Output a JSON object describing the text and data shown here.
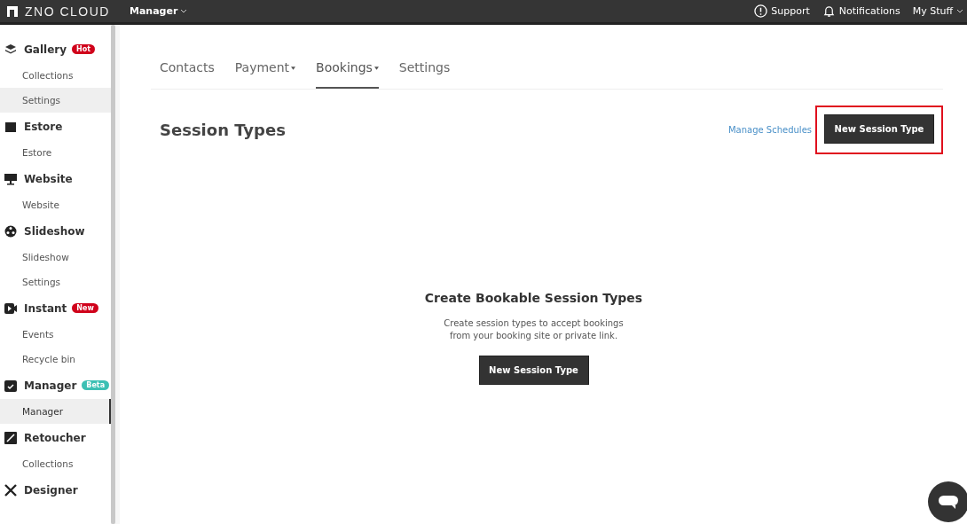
{
  "topbar": {
    "brand": "ZNO CLOUD",
    "menu": "Manager",
    "links": [
      {
        "kind": "support",
        "label": "Support"
      },
      {
        "kind": "bell",
        "label": "Notifications"
      },
      {
        "kind": "menu",
        "label": "My Stuff"
      }
    ]
  },
  "sidebar": {
    "sections": [
      {
        "title": "Gallery",
        "badge": {
          "text": "Hot",
          "color": "#d0021b"
        },
        "items": [
          {
            "label": "Collections",
            "selected": false
          },
          {
            "label": "Settings",
            "selected": false,
            "hovered": true
          }
        ]
      },
      {
        "title": "Estore",
        "items": [
          {
            "label": "Estore",
            "selected": false
          }
        ]
      },
      {
        "title": "Website",
        "items": [
          {
            "label": "Website",
            "selected": false
          }
        ]
      },
      {
        "title": "Slideshow",
        "items": [
          {
            "label": "Slideshow",
            "selected": false
          },
          {
            "label": "Settings",
            "selected": false
          }
        ]
      },
      {
        "title": "Instant",
        "badge": {
          "text": "New",
          "color": "#d0021b"
        },
        "items": [
          {
            "label": "Events",
            "selected": false
          },
          {
            "label": "Recycle bin",
            "selected": false
          }
        ]
      },
      {
        "title": "Manager",
        "badge": {
          "text": "Beta",
          "color": "#3cc0b4"
        },
        "items": [
          {
            "label": "Manager",
            "selected": true
          }
        ]
      },
      {
        "title": "Retoucher",
        "items": [
          {
            "label": "Collections",
            "selected": false
          }
        ]
      },
      {
        "title": "Designer"
      }
    ]
  },
  "tabs": [
    {
      "label": "Contacts",
      "dropdown": false,
      "selected": false
    },
    {
      "label": "Payment",
      "dropdown": true,
      "selected": false
    },
    {
      "label": "Bookings",
      "dropdown": true,
      "selected": true
    },
    {
      "label": "Settings",
      "dropdown": false,
      "selected": false
    }
  ],
  "page": {
    "title": "Session Types",
    "link": "Manage Schedules",
    "button": {
      "label": "New Session Type",
      "highlighted": true
    }
  },
  "empty_state": {
    "title": "Create Bookable Session Types",
    "text": "Create session types to accept bookings from your booking site or private link.",
    "button": "New Session Type"
  }
}
